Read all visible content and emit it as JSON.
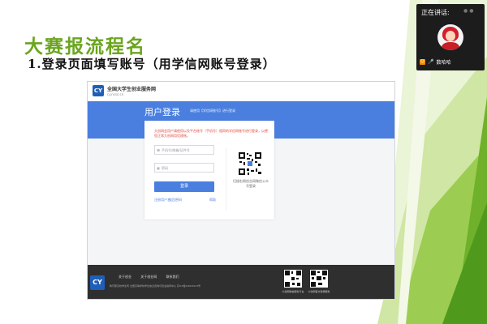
{
  "slide": {
    "title": "大赛报流程名",
    "subtitle": "1.登录页面填写账号（用学信网账号登录）"
  },
  "website": {
    "site_name": "全国大学生创业服务网",
    "site_domain": "cy.ncss.cn",
    "logo_text": "CY",
    "page_title": "用户登录",
    "page_subtitle": "请使用【学信网账号】进行登录",
    "notice": "大创网会用户请使用以及平台账号（手机号）相同的学信网账号进行登录，以便您正常大创网用信理账。",
    "username_placeholder": "手机号/邮箱/证件号",
    "password_placeholder": "密码",
    "login_button": "登录",
    "register_link": "注册用户名",
    "forgot_link": "找回密码",
    "help_link": "帮助",
    "qr_caption": "扫描右侧创业网微信公众号登录",
    "footer": {
      "links": [
        "关于创业",
        "关于创业网",
        "联系我们"
      ],
      "copyright": "教育部高校学生司 全国高等学校学生信息咨询与就业指导中心 京ICP备19004913号",
      "qr_captions": [
        "大创网微信服务平台",
        "大创网官方微博服务"
      ]
    }
  },
  "meeting": {
    "status_label": "正在讲话:",
    "speaker_name": "数哈哈"
  },
  "colors": {
    "title_green": "#6aa51e",
    "site_blue": "#4a7fe0",
    "notice_red": "#e0453b",
    "footer_dark": "#2f2f2f"
  },
  "icons": [
    "user-icon",
    "lock-icon",
    "microphone-icon",
    "person-badge-icon"
  ]
}
